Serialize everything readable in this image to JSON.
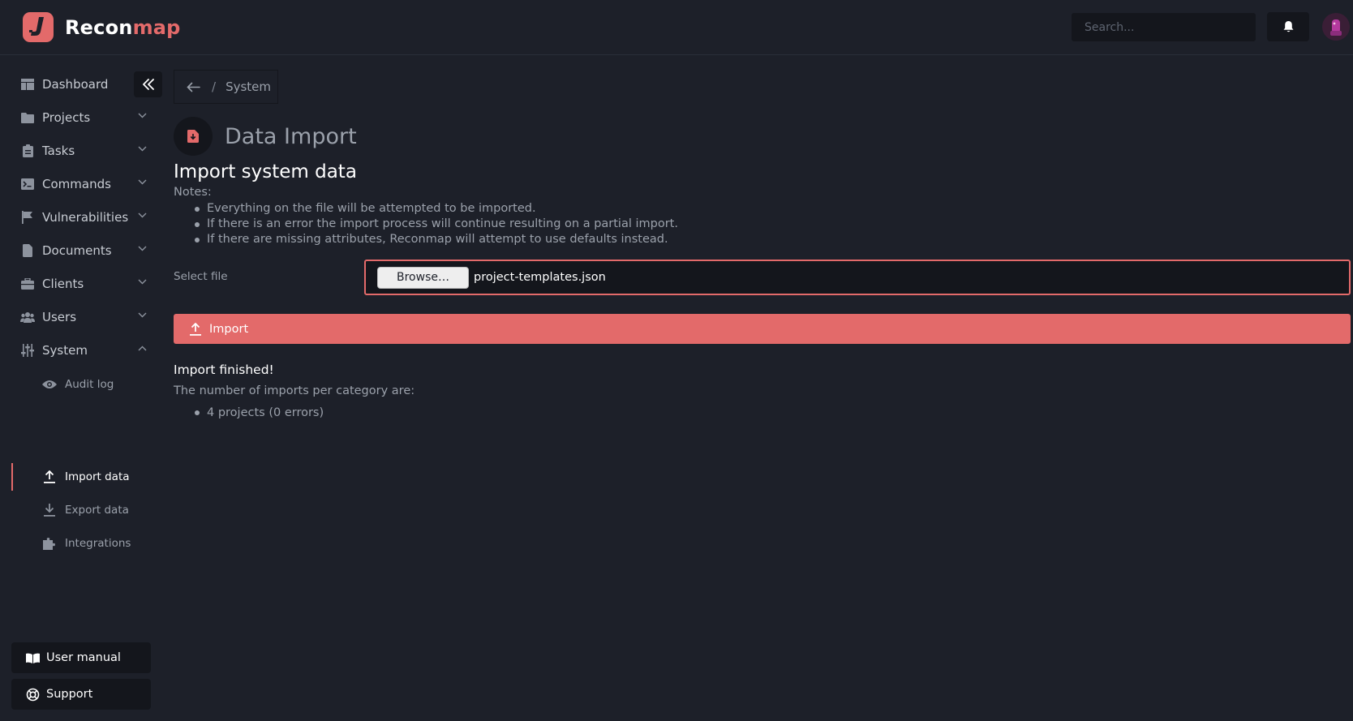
{
  "app": {
    "brand_part1": "Recon",
    "brand_part2": "map",
    "accent_color": "#e36a6a"
  },
  "header": {
    "search_placeholder": "Search...",
    "bell_icon": "bell-icon",
    "avatar_icon": "user-avatar"
  },
  "sidebar": {
    "items": [
      {
        "label": "Dashboard",
        "icon": "dashboard-icon"
      },
      {
        "label": "Projects",
        "icon": "folder-icon"
      },
      {
        "label": "Tasks",
        "icon": "clipboard-icon"
      },
      {
        "label": "Commands",
        "icon": "terminal-icon"
      },
      {
        "label": "Vulnerabilities",
        "icon": "flag-icon"
      },
      {
        "label": "Documents",
        "icon": "document-icon"
      },
      {
        "label": "Clients",
        "icon": "briefcase-icon"
      },
      {
        "label": "Users",
        "icon": "users-icon"
      },
      {
        "label": "System",
        "icon": "sliders-icon"
      }
    ],
    "system_sub": [
      {
        "label": "Audit log",
        "icon": "eye-icon"
      },
      {
        "label": "Import data",
        "icon": "upload-icon"
      },
      {
        "label": "Export data",
        "icon": "download-icon"
      },
      {
        "label": "Integrations",
        "icon": "puzzle-icon"
      }
    ],
    "footer": {
      "manual_label": "User manual",
      "support_label": "Support"
    }
  },
  "breadcrumb": {
    "current": "System",
    "separator": "/"
  },
  "page": {
    "title": "Data Import",
    "section_title": "Import system data",
    "notes_label": "Notes:",
    "notes": [
      "Everything on the file will be attempted to be imported.",
      "If there is an error the import process will continue resulting on a partial import.",
      "If there are missing attributes, Reconmap will attempt to use defaults instead."
    ],
    "select_file_label": "Select file",
    "browse_label": "Browse…",
    "file_name": "project-templates.json",
    "import_label": "Import",
    "result_title": "Import finished!",
    "result_sub": "The number of imports per category are:",
    "results": [
      "4 projects (0 errors)"
    ]
  }
}
